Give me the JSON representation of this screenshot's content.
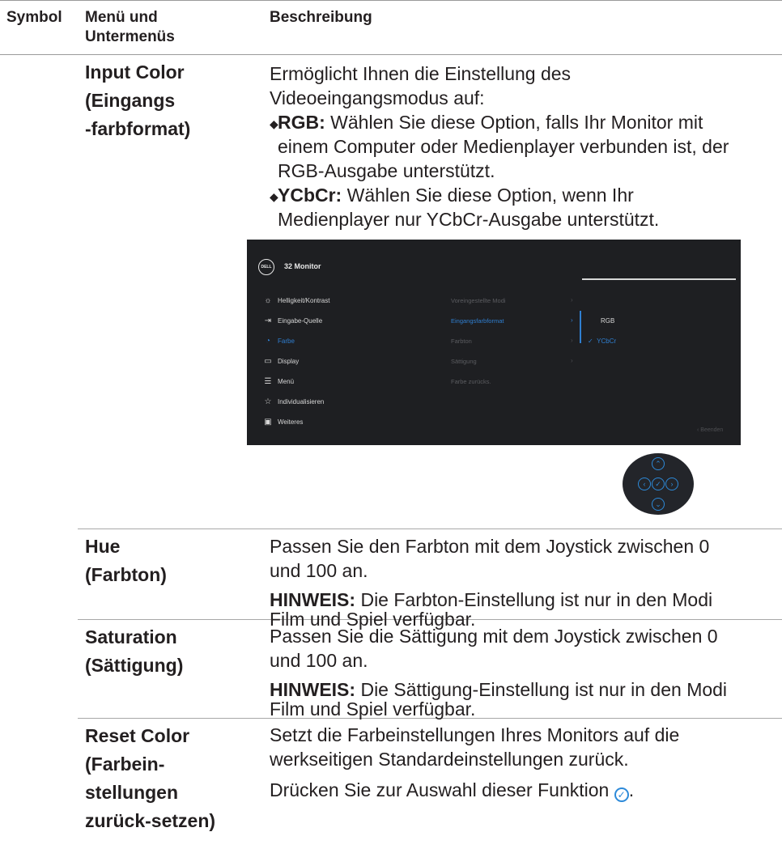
{
  "header": {
    "col_symbol": "Symbol",
    "col_menu": [
      "Menü und",
      "Untermenüs"
    ],
    "col_desc": "Beschreibung"
  },
  "rows": {
    "input_color": {
      "menu": [
        "Input Color",
        "(Eingangs",
        "-farbformat)"
      ],
      "intro": [
        "Ermöglicht Ihnen die Einstellung des",
        "Videoeingangsmodus auf:"
      ],
      "bullets": [
        {
          "bold": "RGB:",
          "lines": [
            " Wählen Sie diese Option, falls Ihr Monitor mit",
            "einem Computer oder Medienplayer verbunden ist, der",
            "RGB-Ausgabe unterstützt."
          ]
        },
        {
          "bold": "YCbCr:",
          "lines": [
            " Wählen Sie diese Option, wenn Ihr",
            "Medienplayer nur YCbCr-Ausgabe unterstützt."
          ]
        }
      ]
    },
    "hue": {
      "menu": [
        "Hue",
        "(Farbton)"
      ],
      "desc": [
        "Passen Sie den Farbton mit dem Joystick zwischen 0",
        "und 100 an."
      ],
      "note_bold": "HINWEIS:",
      "note": [
        " Die Farbton-Einstellung ist nur in den Modi",
        "Film und Spiel verfügbar."
      ]
    },
    "saturation": {
      "menu": [
        "Saturation",
        "(Sättigung)"
      ],
      "desc": [
        "Passen Sie die Sättigung mit dem Joystick zwischen 0",
        "und 100 an."
      ],
      "note_bold": "HINWEIS:",
      "note": [
        " Die Sättigung-Einstellung ist nur in den Modi",
        "Film und Spiel verfügbar."
      ]
    },
    "reset": {
      "menu": [
        "Reset Color",
        "(Farbein-",
        "stellungen",
        "zurück-setzen)"
      ],
      "desc": [
        "Setzt die Farbeinstellungen Ihres Monitors auf die",
        "werkseitigen Standardeinstellungen zurück."
      ],
      "press": "Drücken Sie zur Auswahl dieser Funktion ",
      "press_end": "."
    }
  },
  "osd": {
    "logo": "DELL",
    "title": "32 Monitor",
    "menu": [
      {
        "label": "Helligkeit/Kontrast",
        "icon": "sun-icon",
        "glyph": "☼"
      },
      {
        "label": "Eingabe-Quelle",
        "icon": "input-icon",
        "glyph": "⇥"
      },
      {
        "label": "Farbe",
        "icon": "palette-icon",
        "glyph": "◔"
      },
      {
        "label": "Display",
        "icon": "display-icon",
        "glyph": "▭"
      },
      {
        "label": "Menü",
        "icon": "menu-icon",
        "glyph": "☰"
      },
      {
        "label": "Individualisieren",
        "icon": "star-icon",
        "glyph": "☆"
      },
      {
        "label": "Weiteres",
        "icon": "info-icon",
        "glyph": "▣"
      }
    ],
    "submenu": [
      "Voreingestellte Modi",
      "Eingangsfarbformat",
      "Farbton",
      "Sättigung",
      "Farbe zurücks."
    ],
    "options": [
      "RGB",
      "YCbCr"
    ],
    "exit": "‹  Beenden",
    "accent": "#2f7fd1"
  },
  "joystick": {
    "up": "⌃",
    "down": "⌄",
    "left": "‹",
    "right": "›",
    "center": "✓",
    "accent": "#2d8ad9"
  }
}
